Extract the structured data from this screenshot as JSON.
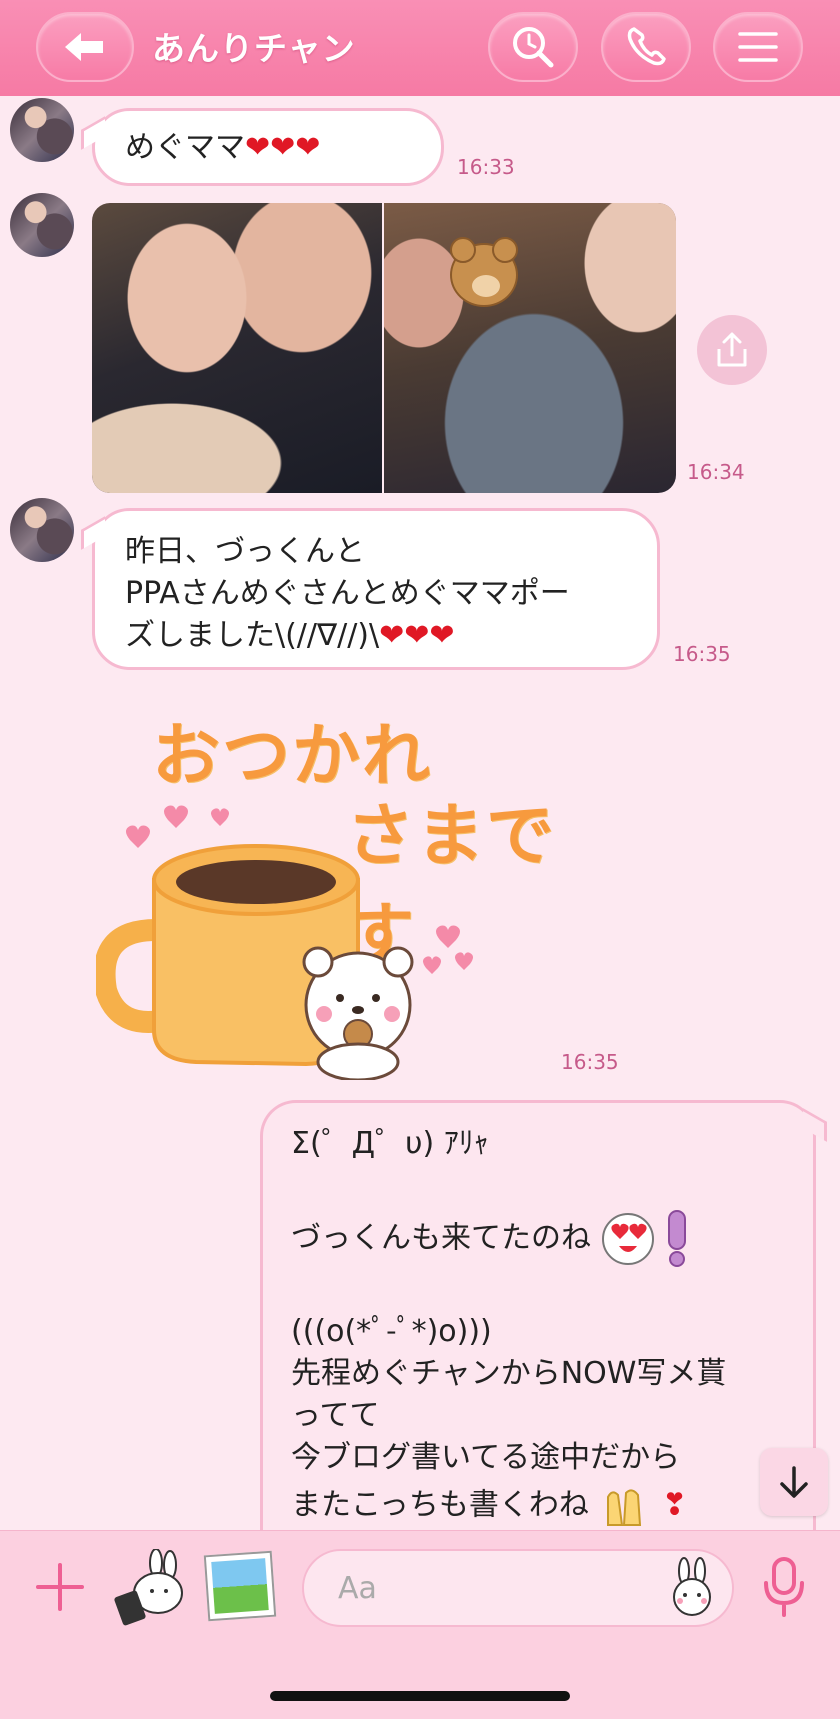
{
  "header": {
    "title": "あんりチャン",
    "back_icon": "back-arrow-icon",
    "search_icon": "search-icon",
    "phone_icon": "phone-icon",
    "menu_icon": "menu-icon"
  },
  "messages": [
    {
      "type": "text",
      "text": "めぐママ",
      "hearts": "❤❤❤",
      "time": "16:33"
    },
    {
      "type": "photos",
      "time": "16:34"
    },
    {
      "type": "text",
      "lines": [
        "昨日、づっくんと",
        "PPAさんめぐさんとめぐママポー",
        "ズしました\\(//∇//)\\"
      ],
      "hearts": "❤❤❤",
      "time": "16:35"
    },
    {
      "type": "sticker",
      "text1": "おつかれ",
      "text2": "さまです",
      "time": "16:35"
    }
  ],
  "sent": {
    "lines": [
      "Σ(゜Д゜υ) ｱﾘｬ",
      "",
      "づっくんも来てたのね",
      "",
      "(((o(*゜▽゜*)o)))",
      "先程めぐチャンからNOW写メ貰",
      "ってて",
      "今ブログ書いてる途中だから",
      "またこっちも書くわね"
    ],
    "line5": "(((o(*ﾟ-ﾟ*)o)))",
    "heart": "❣"
  },
  "input": {
    "placeholder": "Aa"
  },
  "colors": {
    "accent": "#f67aa4",
    "bubble_border": "#f6b9d0",
    "time": "#c65a8a",
    "background": "#fde9f1"
  }
}
